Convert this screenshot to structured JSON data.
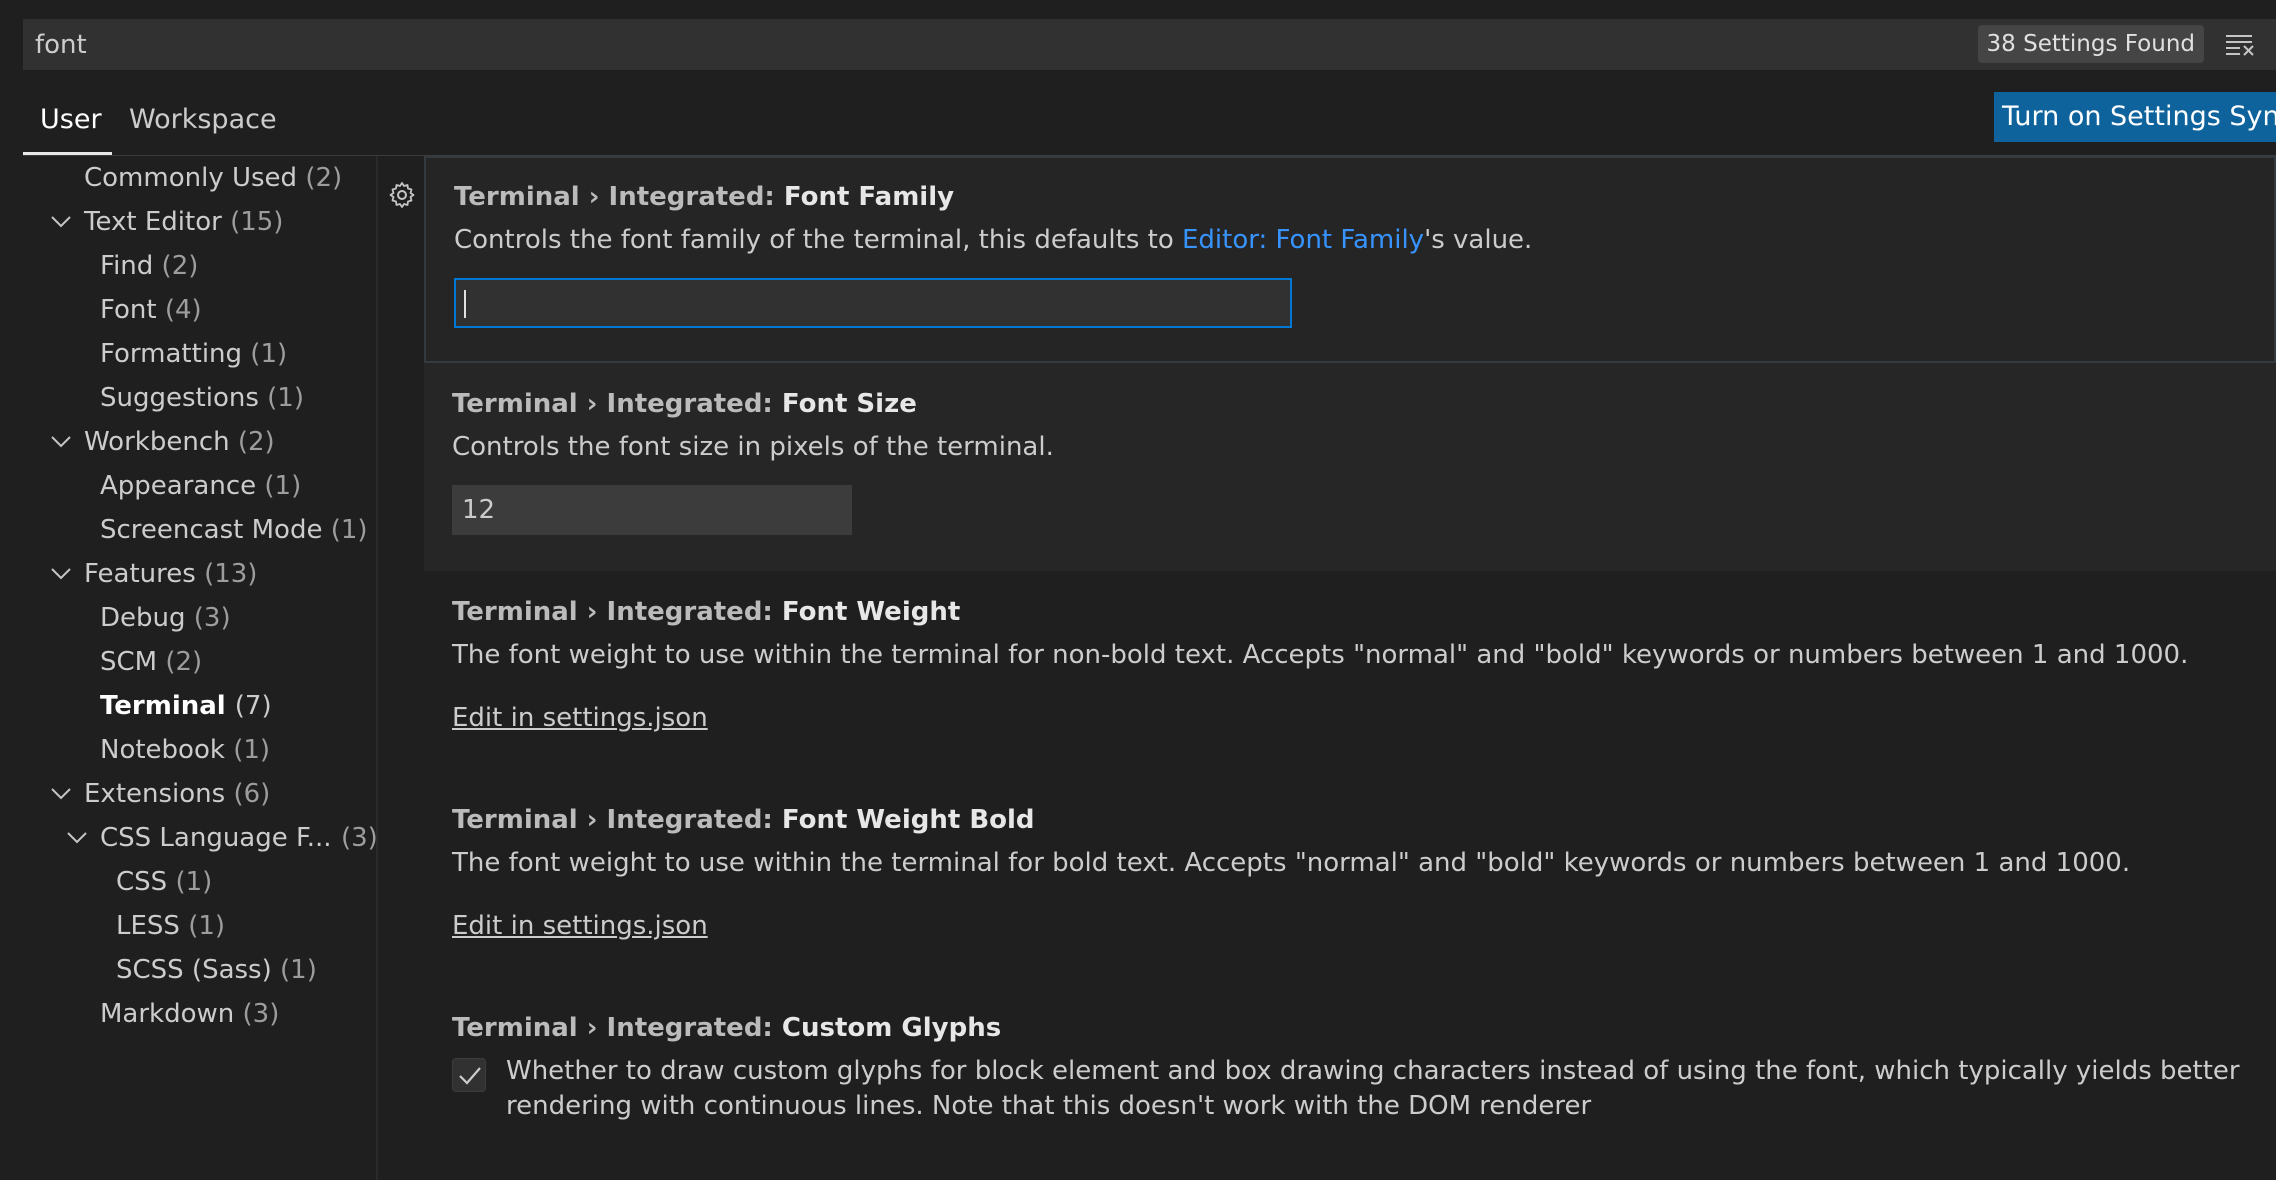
{
  "search": {
    "query": "font",
    "results_badge": "38 Settings Found"
  },
  "tabs": {
    "user": "User",
    "workspace": "Workspace"
  },
  "sync_button": "Turn on Settings Sync",
  "toc": [
    {
      "label": "Commonly Used",
      "count": "(2)"
    },
    {
      "label": "Text Editor",
      "count": "(15)"
    },
    {
      "label": "Find",
      "count": "(2)"
    },
    {
      "label": "Font",
      "count": "(4)"
    },
    {
      "label": "Formatting",
      "count": "(1)"
    },
    {
      "label": "Suggestions",
      "count": "(1)"
    },
    {
      "label": "Workbench",
      "count": "(2)"
    },
    {
      "label": "Appearance",
      "count": "(1)"
    },
    {
      "label": "Screencast Mode",
      "count": "(1)"
    },
    {
      "label": "Features",
      "count": "(13)"
    },
    {
      "label": "Debug",
      "count": "(3)"
    },
    {
      "label": "SCM",
      "count": "(2)"
    },
    {
      "label": "Terminal",
      "count": "(7)"
    },
    {
      "label": "Notebook",
      "count": "(1)"
    },
    {
      "label": "Extensions",
      "count": "(6)"
    },
    {
      "label": "CSS Language F...",
      "count": "(3)"
    },
    {
      "label": "CSS",
      "count": "(1)"
    },
    {
      "label": "LESS",
      "count": "(1)"
    },
    {
      "label": "SCSS (Sass)",
      "count": "(1)"
    },
    {
      "label": "Markdown",
      "count": "(3)"
    }
  ],
  "settings": [
    {
      "category": "Terminal › Integrated: ",
      "name": "Font Family",
      "desc_before": "Controls the font family of the terminal, this defaults to ",
      "desc_link": "Editor: Font Family",
      "desc_after": "'s value.",
      "value": ""
    },
    {
      "category": "Terminal › Integrated: ",
      "name": "Font Size",
      "desc": "Controls the font size in pixels of the terminal.",
      "value": "12"
    },
    {
      "category": "Terminal › Integrated: ",
      "name": "Font Weight",
      "desc": "The font weight to use within the terminal for non-bold text. Accepts \"normal\" and \"bold\" keywords or numbers between 1 and 1000.",
      "edit_link": "Edit in settings.json"
    },
    {
      "category": "Terminal › Integrated: ",
      "name": "Font Weight Bold",
      "desc": "The font weight to use within the terminal for bold text. Accepts \"normal\" and \"bold\" keywords or numbers between 1 and 1000.",
      "edit_link": "Edit in settings.json"
    },
    {
      "category": "Terminal › Integrated: ",
      "name": "Custom Glyphs",
      "desc": "Whether to draw custom glyphs for block element and box drawing characters instead of using the font, which typically yields better rendering with continuous lines. Note that this doesn't work with the DOM renderer",
      "checked": true
    }
  ],
  "colors": {
    "accent": "#0078d4",
    "button": "#0e639c",
    "link": "#3794ff",
    "background": "#1f1f1f"
  }
}
